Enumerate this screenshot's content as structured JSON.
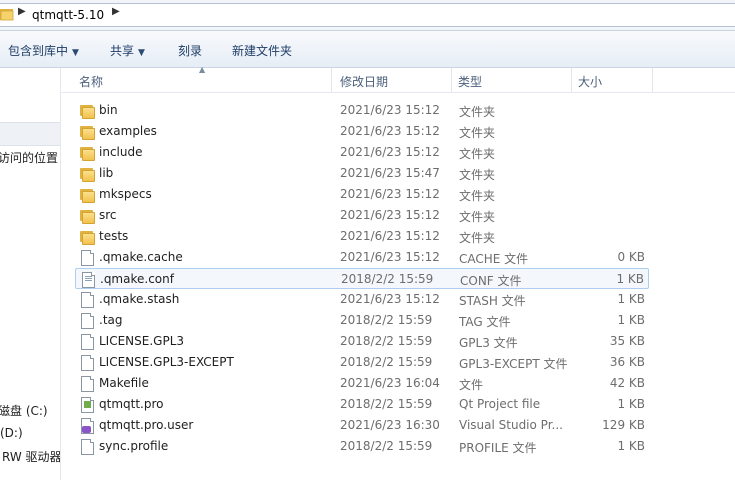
{
  "address_bar": {
    "crumb": "qtmqtt-5.10"
  },
  "toolbar": {
    "include_in_library": "包含到库中",
    "share": "共享",
    "burn": "刻录",
    "new_folder": "新建文件夹"
  },
  "nav_pane": {
    "recent_places": "访问的位置",
    "disk_c": "磁盘 (C:)",
    "disk_d": "(D:)",
    "rw_drive": "RW 驱动器"
  },
  "columns": {
    "name": "名称",
    "modified": "修改日期",
    "type": "类型",
    "size": "大小"
  },
  "files": [
    {
      "name": "bin",
      "date": "2021/6/23 15:12",
      "type": "文件夹",
      "size": "",
      "icon": "folder-icon"
    },
    {
      "name": "examples",
      "date": "2021/6/23 15:12",
      "type": "文件夹",
      "size": "",
      "icon": "folder-icon"
    },
    {
      "name": "include",
      "date": "2021/6/23 15:12",
      "type": "文件夹",
      "size": "",
      "icon": "folder-icon"
    },
    {
      "name": "lib",
      "date": "2021/6/23 15:47",
      "type": "文件夹",
      "size": "",
      "icon": "folder-icon"
    },
    {
      "name": "mkspecs",
      "date": "2021/6/23 15:12",
      "type": "文件夹",
      "size": "",
      "icon": "folder-icon"
    },
    {
      "name": "src",
      "date": "2021/6/23 15:12",
      "type": "文件夹",
      "size": "",
      "icon": "folder-icon"
    },
    {
      "name": "tests",
      "date": "2021/6/23 15:12",
      "type": "文件夹",
      "size": "",
      "icon": "folder-icon"
    },
    {
      "name": ".qmake.cache",
      "date": "2021/6/23 15:12",
      "type": "CACHE 文件",
      "size": "0 KB",
      "icon": "file-icon"
    },
    {
      "name": ".qmake.conf",
      "date": "2018/2/2 15:59",
      "type": "CONF 文件",
      "size": "1 KB",
      "icon": "config-file-icon"
    },
    {
      "name": ".qmake.stash",
      "date": "2021/6/23 15:12",
      "type": "STASH 文件",
      "size": "1 KB",
      "icon": "file-icon"
    },
    {
      "name": ".tag",
      "date": "2018/2/2 15:59",
      "type": "TAG 文件",
      "size": "1 KB",
      "icon": "file-icon"
    },
    {
      "name": "LICENSE.GPL3",
      "date": "2018/2/2 15:59",
      "type": "GPL3 文件",
      "size": "35 KB",
      "icon": "file-icon"
    },
    {
      "name": "LICENSE.GPL3-EXCEPT",
      "date": "2018/2/2 15:59",
      "type": "GPL3-EXCEPT 文件",
      "size": "36 KB",
      "icon": "file-icon"
    },
    {
      "name": "Makefile",
      "date": "2021/6/23 16:04",
      "type": "文件",
      "size": "42 KB",
      "icon": "file-icon"
    },
    {
      "name": "qtmqtt.pro",
      "date": "2018/2/2 15:59",
      "type": "Qt Project file",
      "size": "1 KB",
      "icon": "qt-project-icon"
    },
    {
      "name": "qtmqtt.pro.user",
      "date": "2021/6/23 16:30",
      "type": "Visual Studio Pr...",
      "size": "129 KB",
      "icon": "visual-studio-icon"
    },
    {
      "name": "sync.profile",
      "date": "2018/2/2 15:59",
      "type": "PROFILE 文件",
      "size": "1 KB",
      "icon": "file-icon"
    }
  ],
  "highlighted_row": 8
}
